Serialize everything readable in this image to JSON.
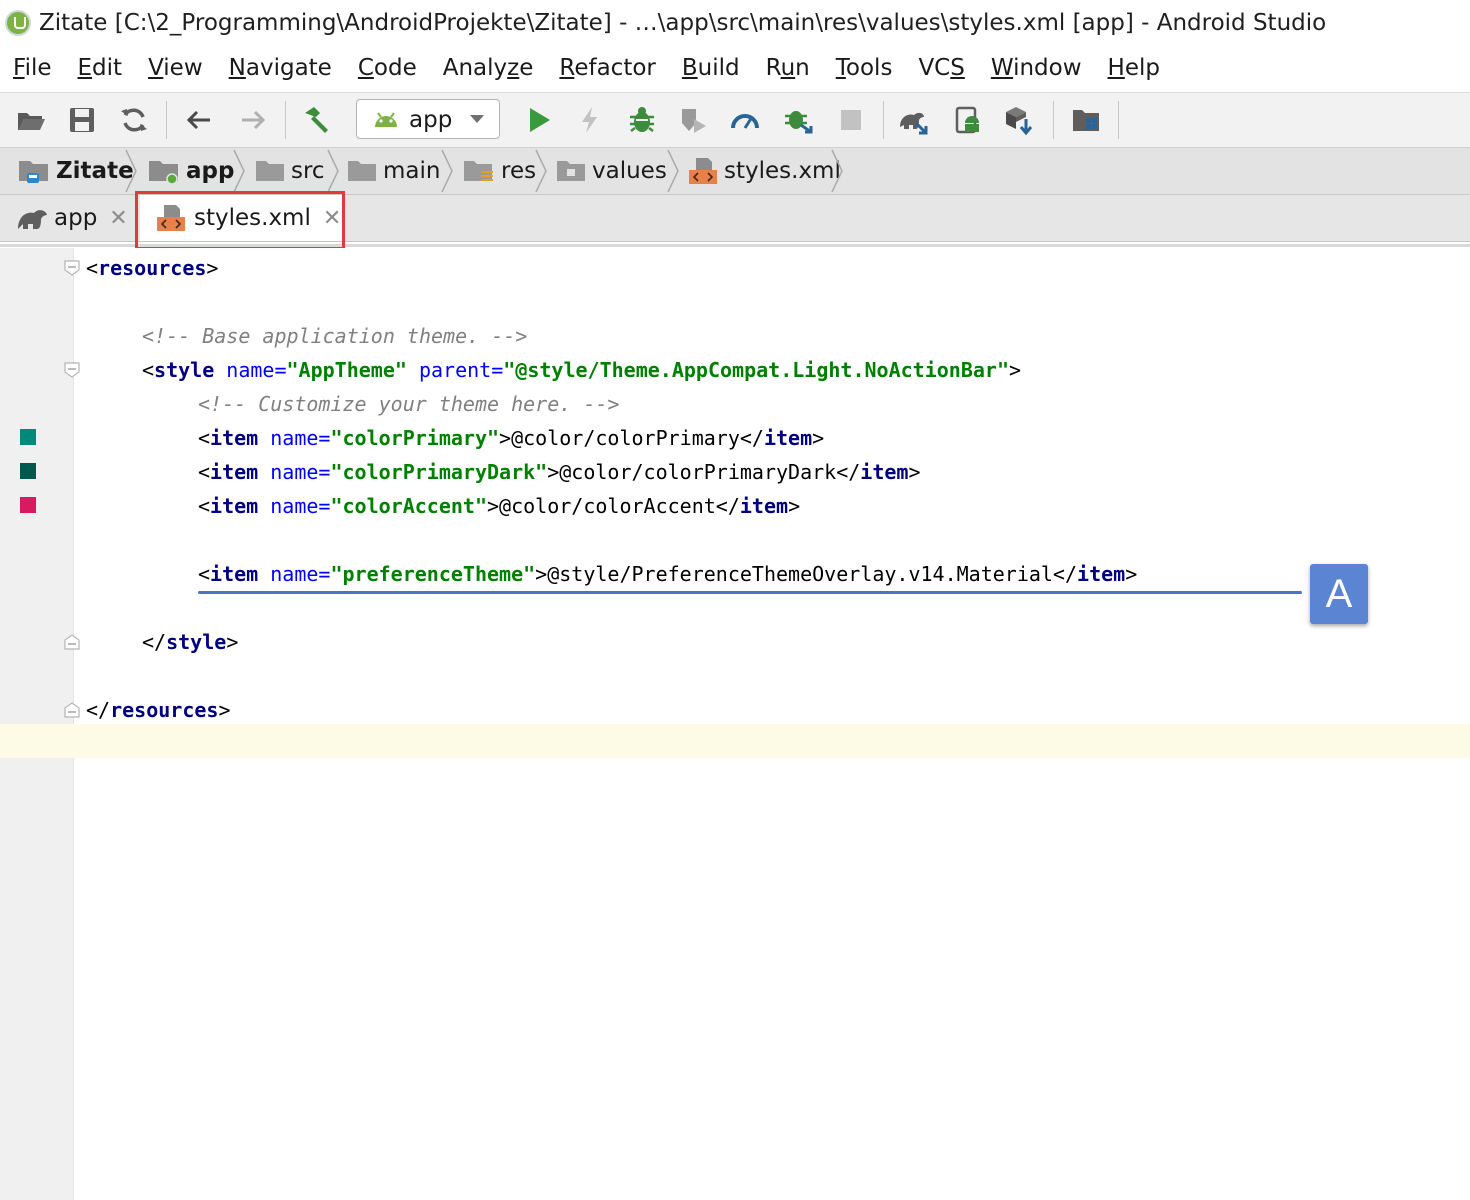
{
  "window": {
    "title": "Zitate [C:\\2_Programming\\AndroidProjekte\\Zitate] - …\\app\\src\\main\\res\\values\\styles.xml [app] - Android Studio"
  },
  "menu": [
    {
      "pre": "",
      "u": "F",
      "post": "ile"
    },
    {
      "pre": "",
      "u": "E",
      "post": "dit"
    },
    {
      "pre": "",
      "u": "V",
      "post": "iew"
    },
    {
      "pre": "",
      "u": "N",
      "post": "avigate"
    },
    {
      "pre": "",
      "u": "C",
      "post": "ode"
    },
    {
      "pre": "Analy",
      "u": "z",
      "post": "e"
    },
    {
      "pre": "",
      "u": "R",
      "post": "efactor"
    },
    {
      "pre": "",
      "u": "B",
      "post": "uild"
    },
    {
      "pre": "R",
      "u": "u",
      "post": "n"
    },
    {
      "pre": "",
      "u": "T",
      "post": "ools"
    },
    {
      "pre": "VC",
      "u": "S",
      "post": ""
    },
    {
      "pre": "",
      "u": "W",
      "post": "indow"
    },
    {
      "pre": "",
      "u": "H",
      "post": "elp"
    }
  ],
  "toolbar": {
    "run_config": "app",
    "icons": [
      "open-folder-icon",
      "save-icon",
      "sync-icon",
      "back-arrow-icon",
      "forward-arrow-icon",
      "build-hammer-icon",
      "run-icon",
      "apply-changes-icon",
      "debug-icon",
      "coverage-icon",
      "profile-icon",
      "attach-debugger-icon",
      "stop-icon",
      "gradle-sync-icon",
      "avd-manager-icon",
      "sdk-manager-icon",
      "project-structure-icon"
    ]
  },
  "breadcrumb": [
    "Zitate",
    "app",
    "src",
    "main",
    "res",
    "values",
    "styles.xml"
  ],
  "tabs": [
    {
      "label": "app",
      "active": false
    },
    {
      "label": "styles.xml",
      "active": true
    }
  ],
  "code": {
    "l1": {
      "a": "<",
      "b": "resources",
      "c": ">"
    },
    "l3": {
      "a": "<!-- Base application theme. -->"
    },
    "l4": {
      "a": "<",
      "b": "style",
      "c": " name=",
      "d": "\"AppTheme\"",
      "e": " parent=",
      "f": "\"@style/Theme.AppCompat.Light.NoActionBar\"",
      "g": ">"
    },
    "l5": {
      "a": "<!-- Customize your theme here. -->"
    },
    "l6": {
      "a": "<",
      "b": "item",
      "c": " name=",
      "d": "\"colorPrimary\"",
      "e": ">@color/colorPrimary</",
      "f": "item",
      "g": ">"
    },
    "l7": {
      "a": "<",
      "b": "item",
      "c": " name=",
      "d": "\"colorPrimaryDark\"",
      "e": ">@color/colorPrimaryDark</",
      "f": "item",
      "g": ">"
    },
    "l8": {
      "a": "<",
      "b": "item",
      "c": " name=",
      "d": "\"colorAccent\"",
      "e": ">@color/colorAccent</",
      "f": "item",
      "g": ">"
    },
    "l10": {
      "a": "<",
      "b": "item",
      "c": " name=",
      "d": "\"preferenceTheme\"",
      "e": ">@style/PreferenceThemeOverlay.v14.Material</",
      "f": "item",
      "g": ">"
    },
    "l12": {
      "a": "</",
      "b": "style",
      "c": ">"
    },
    "l14": {
      "a": "</",
      "b": "resources",
      "c": ">"
    }
  },
  "swatches": {
    "colorPrimary": "#00897b",
    "colorPrimaryDark": "#00594f",
    "colorAccent": "#d81b60"
  },
  "annotation": {
    "marker": "A"
  },
  "colors": {
    "highlight_box": "#e0393e",
    "underline": "#4a74c6",
    "marker": "#5b85d3"
  }
}
